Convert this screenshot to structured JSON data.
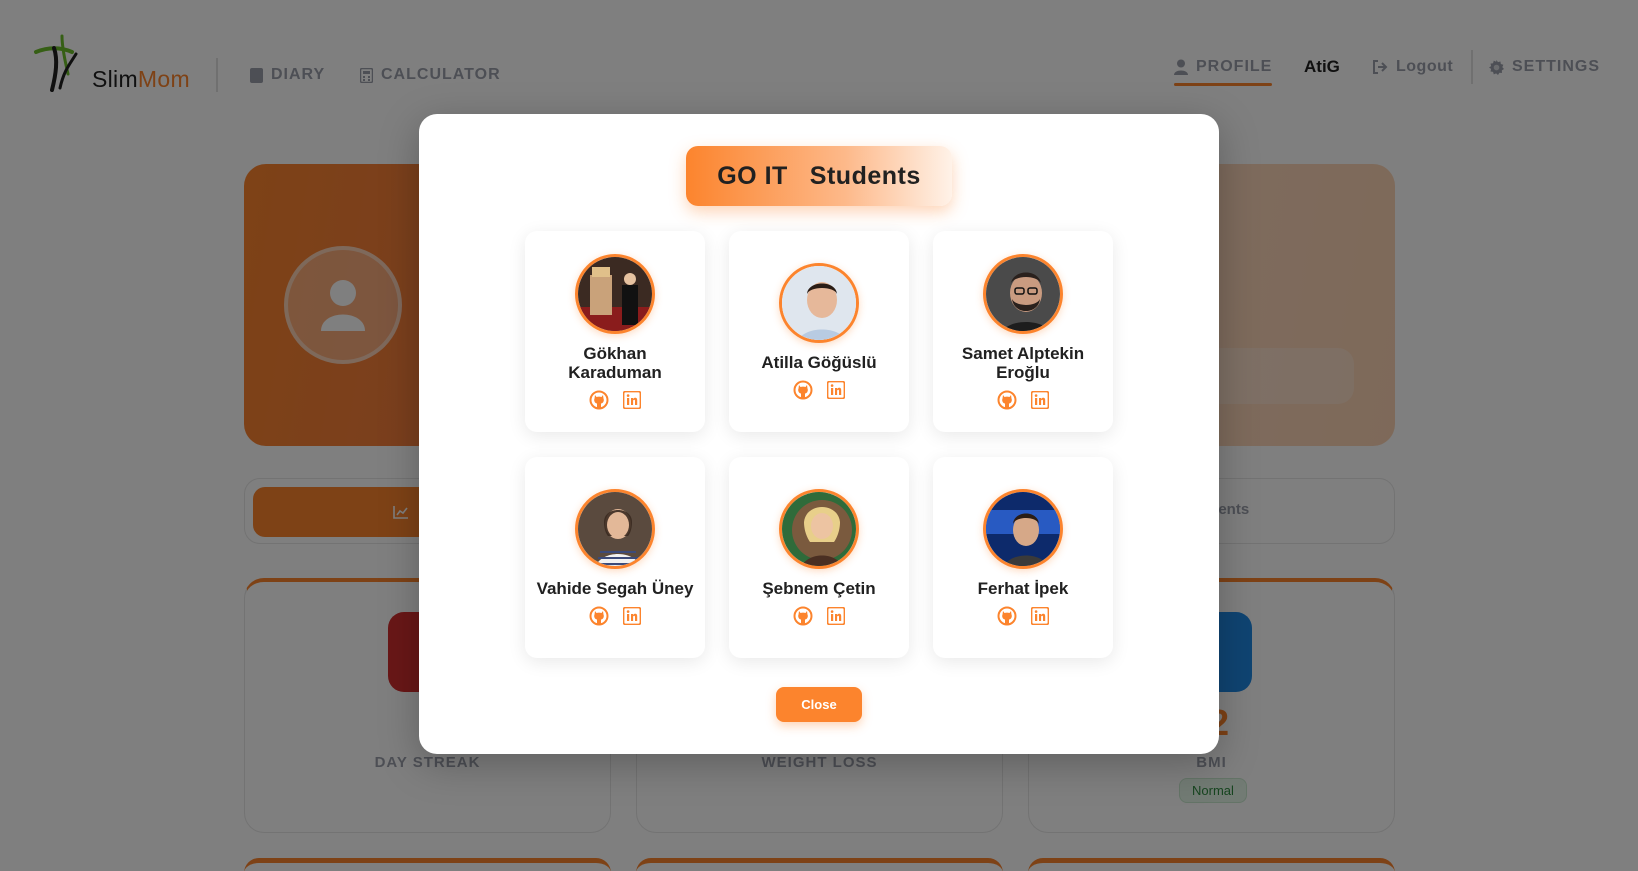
{
  "brand": {
    "name_part1": "Slim",
    "name_part2": "Mom"
  },
  "nav": {
    "diary": "DIARY",
    "calculator": "CALCULATOR",
    "profile": "PROFILE",
    "username": "AtiG",
    "logout": "Logout",
    "settings": "SETTINGS"
  },
  "background": {
    "tab_partial": "ments",
    "stats": [
      {
        "label": "DAY STREAK",
        "value": ""
      },
      {
        "label": "WEIGHT LOSS",
        "value": ""
      },
      {
        "label": "BMI",
        "value": ".2",
        "badge": "Normal"
      }
    ]
  },
  "modal": {
    "title_part1": "GO IT",
    "title_part2": "Students",
    "students": [
      {
        "name": "Gökhan Karaduman"
      },
      {
        "name": "Atilla Göğüslü"
      },
      {
        "name": "Samet Alptekin Eroğlu"
      },
      {
        "name": "Vahide Segah Üney"
      },
      {
        "name": "Şebnem Çetin"
      },
      {
        "name": "Ferhat İpek"
      }
    ],
    "close_label": "Close"
  },
  "colors": {
    "accent": "#fc842d",
    "text": "#212121",
    "muted": "#9b9faa",
    "overlay": "rgba(0,0,0,0.5)"
  }
}
